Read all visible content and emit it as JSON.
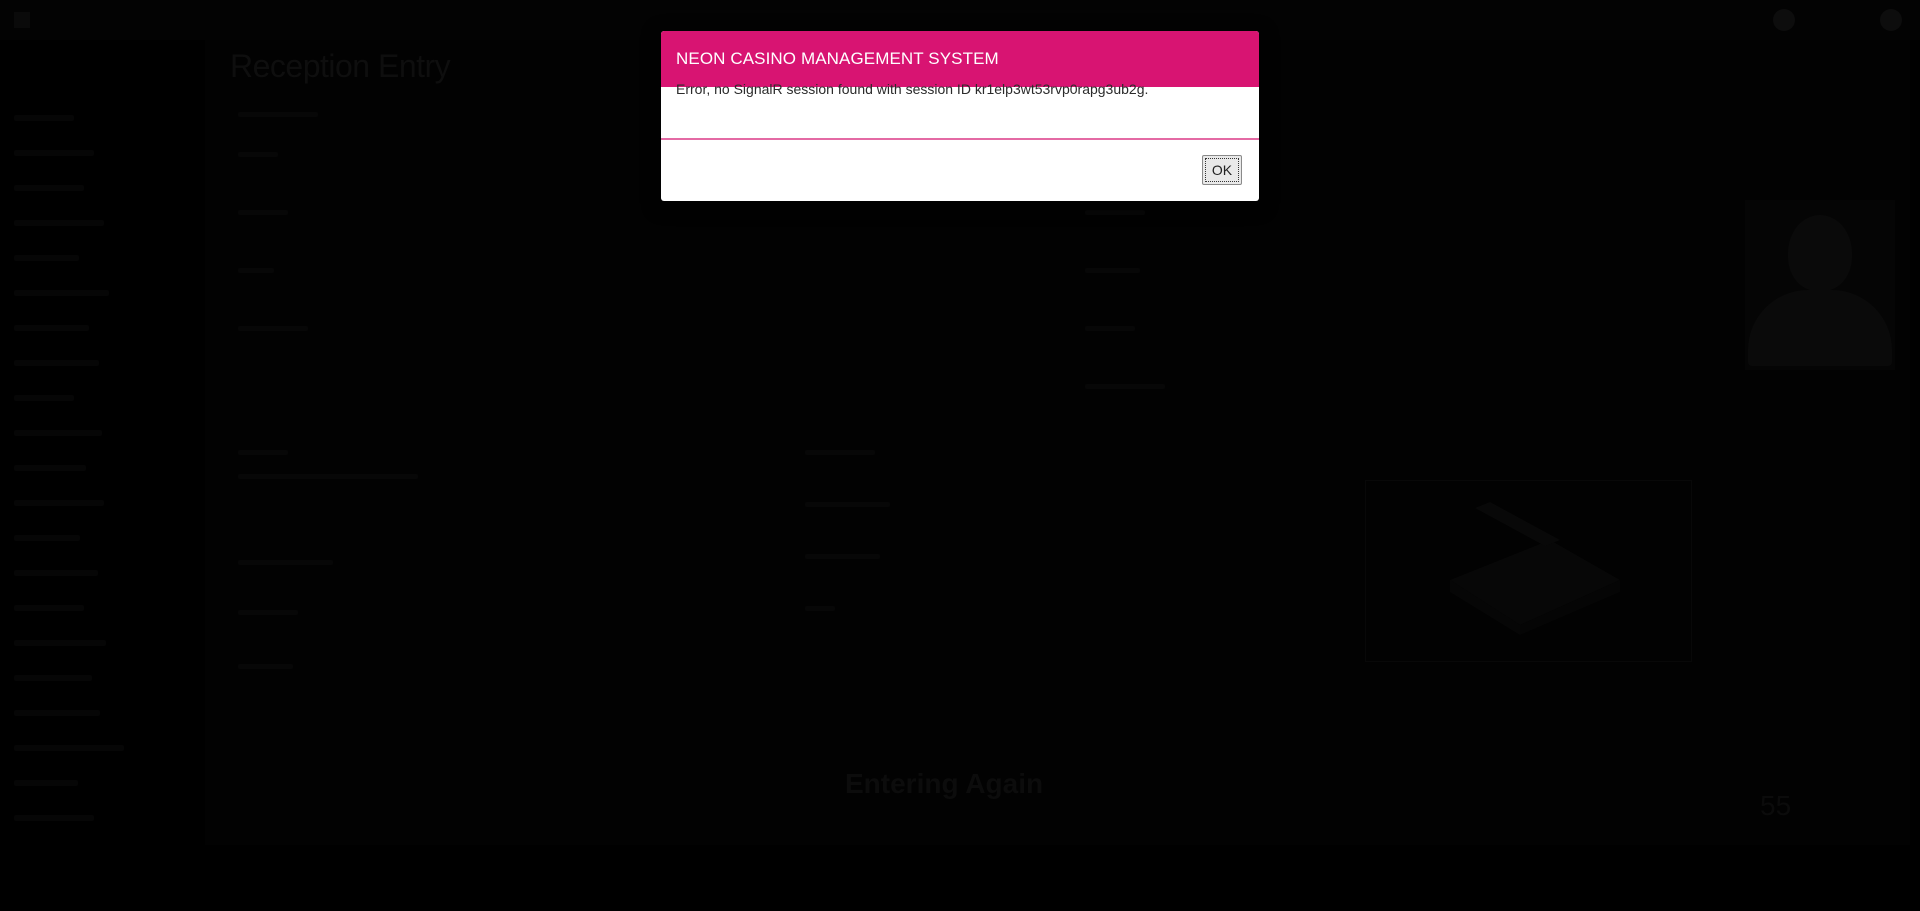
{
  "page": {
    "title": "Reception Entry",
    "entering_again_label": "Entering Again",
    "counter_value": "55"
  },
  "dialog": {
    "title": "NEON CASINO MANAGEMENT SYSTEM",
    "message": "Error, no SignalR session found with session ID kr1elp3wt53rvp0rapg3ub2g.",
    "ok_label": "OK"
  },
  "colors": {
    "dialog_header": "#d81472",
    "dialog_divider": "#e46aa4",
    "backdrop": "#000000"
  },
  "icons": {
    "avatar": "person-silhouette-icon",
    "scanner": "scanner-icon"
  }
}
